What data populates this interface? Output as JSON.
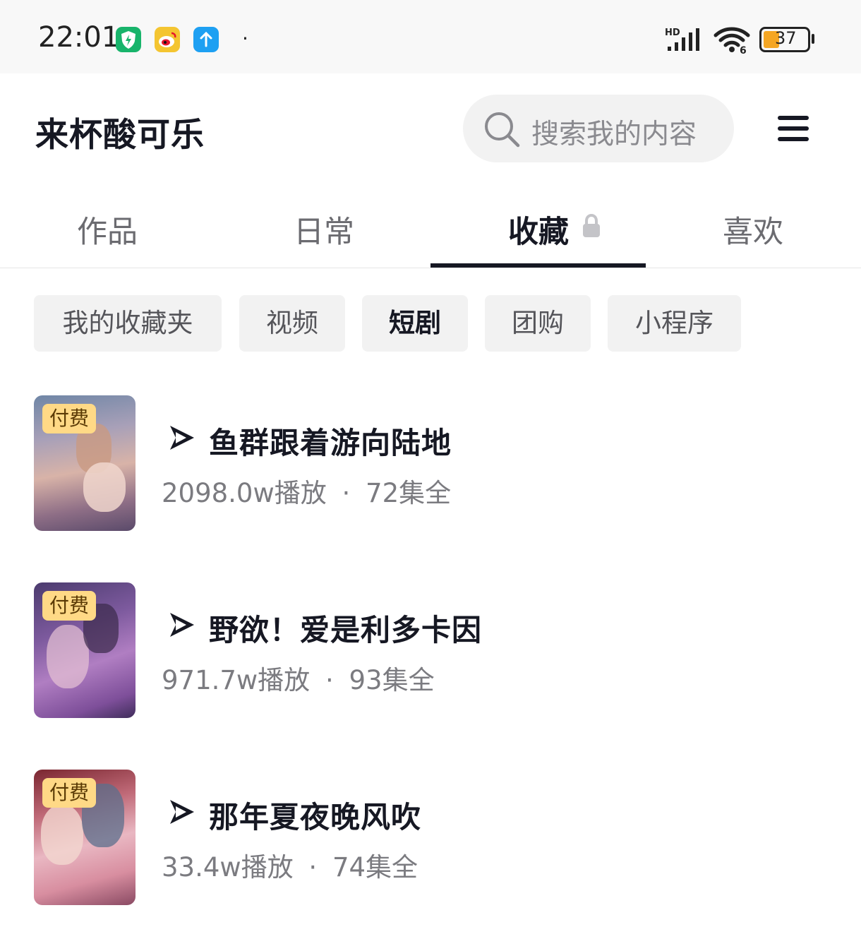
{
  "status_bar": {
    "time": "22:01",
    "dot": "·",
    "battery": "37",
    "network_label": "HD",
    "app_icons": [
      "shield-app-icon",
      "weibo-icon",
      "upload-app-icon"
    ],
    "colors": {
      "shield": "#18b46b",
      "weibo": "#f4c531",
      "upload": "#1ea0f2",
      "battery": "#f5a623"
    }
  },
  "header": {
    "title": "来杯酸可乐",
    "search_placeholder": "搜索我的内容",
    "menu_icon": "hamburger-menu-icon"
  },
  "tabs": [
    {
      "label": "作品",
      "active": false
    },
    {
      "label": "日常",
      "active": false
    },
    {
      "label": "收藏",
      "active": true,
      "locked": true
    },
    {
      "label": "喜欢",
      "active": false
    }
  ],
  "chips": [
    {
      "label": "我的收藏夹",
      "active": false
    },
    {
      "label": "视频",
      "active": false
    },
    {
      "label": "短剧",
      "active": true
    },
    {
      "label": "团购",
      "active": false
    },
    {
      "label": "小程序",
      "active": false
    }
  ],
  "items": [
    {
      "badge": "付费",
      "title": "鱼群跟着游向陆地",
      "plays": "2098.0w播放",
      "sep": "·",
      "episodes": "72集全"
    },
    {
      "badge": "付费",
      "title": "野欲！爱是利多卡因",
      "plays": "971.7w播放",
      "sep": "·",
      "episodes": "93集全"
    },
    {
      "badge": "付费",
      "title": "那年夏夜晚风吹",
      "plays": "33.4w播放",
      "sep": "·",
      "episodes": "74集全"
    }
  ]
}
